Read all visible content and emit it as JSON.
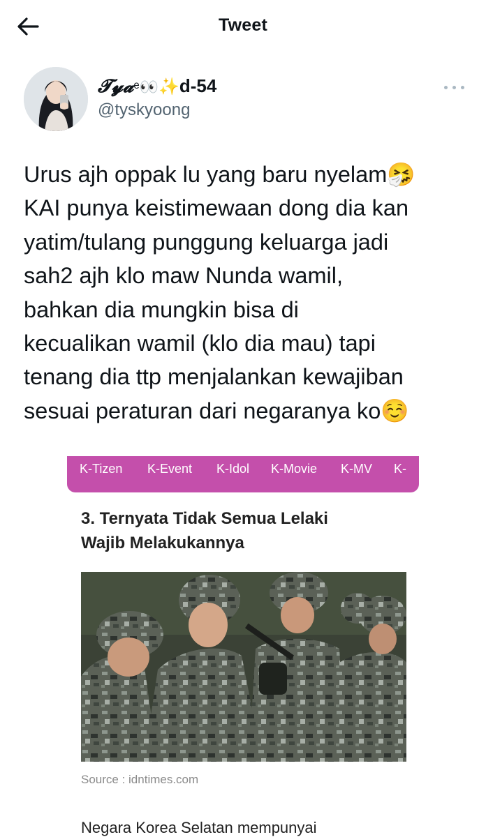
{
  "header": {
    "title": "Tweet",
    "back_icon": "arrow-left-icon"
  },
  "author": {
    "display_name_script": "𝓣𝔂𝓪",
    "display_name_mid": "ᵉ👀",
    "display_name_suffix": "d-54",
    "sparkle": "✨",
    "handle": "@tyskyoong",
    "more_icon": "more-horizontal-icon"
  },
  "tweet": {
    "lines": [
      "Urus ajh oppak lu yang baru nyelam🤧",
      "KAI punya keistimewaan dong dia kan",
      "yatim/tulang punggung keluarga jadi",
      "sah2 ajh klo maw Nunda wamil,",
      "bahkan dia mungkin bisa di",
      "kecualikan wamil (klo dia mau) tapi",
      "tenang dia ttp menjalankan kewajiban",
      "sesuai peraturan dari negaranya ko☺️"
    ]
  },
  "embedded_article": {
    "nav": [
      "K-Tizen",
      "K-Event",
      "K-Idol",
      "K-Movie",
      "K-MV",
      "K-"
    ],
    "heading_lines": [
      "3. Ternyata Tidak Semua Lelaki",
      "Wajib Melakukannya"
    ],
    "source": "Source : idntimes.com",
    "body_start": "Negara Korea Selatan mempunyai"
  },
  "colors": {
    "accent_pill": "#c44fab",
    "text": "#0f1419",
    "muted": "#536471"
  }
}
